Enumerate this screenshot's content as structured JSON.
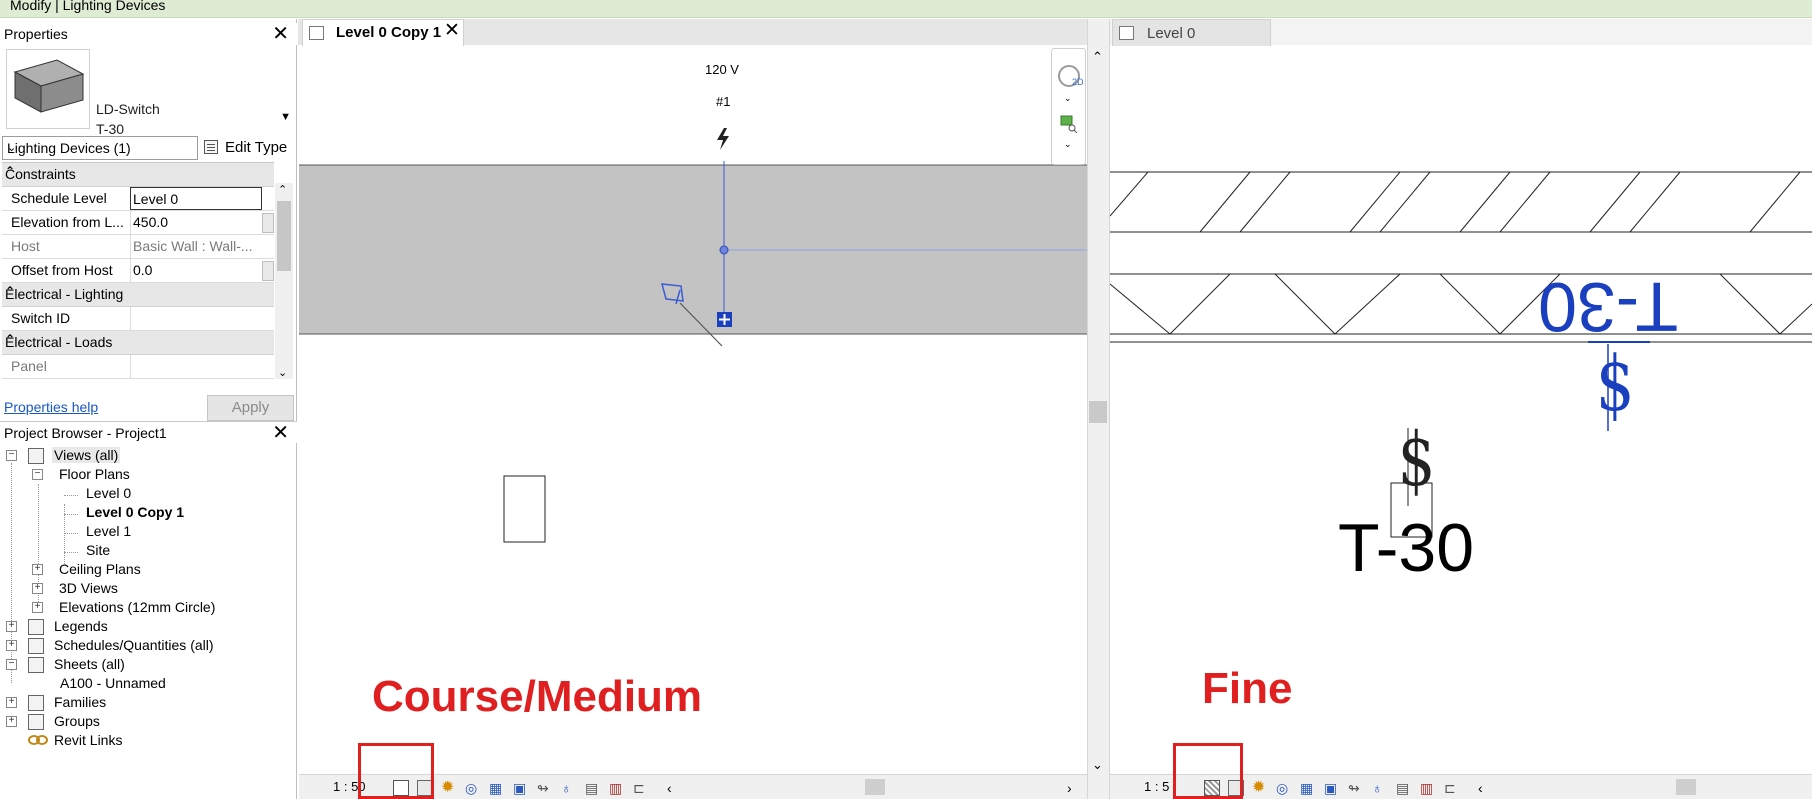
{
  "context_bar": {
    "title": "Modify | Lighting Devices"
  },
  "properties": {
    "title": "Properties",
    "type_family": "LD-Switch",
    "type_name": "T-30",
    "category_selector": "Lighting Devices (1)",
    "edit_type_label": "Edit Type",
    "groups": {
      "constraints": "Constraints",
      "electrical_lighting": "Electrical - Lighting",
      "electrical_loads": "Electrical - Loads"
    },
    "rows": {
      "schedule_level": {
        "label": "Schedule Level",
        "value": "Level 0"
      },
      "elevation": {
        "label": "Elevation from L...",
        "value": "450.0"
      },
      "host": {
        "label": "Host",
        "value": "Basic Wall : Wall-..."
      },
      "offset": {
        "label": "Offset from Host",
        "value": "0.0"
      },
      "switch_id": {
        "label": "Switch ID",
        "value": ""
      },
      "panel": {
        "label": "Panel",
        "value": ""
      }
    },
    "help_link": "Properties help",
    "apply_label": "Apply"
  },
  "project_browser": {
    "title": "Project Browser - Project1",
    "items": [
      {
        "label": "Views (all)"
      },
      {
        "label": "Floor Plans"
      },
      {
        "label": "Level 0"
      },
      {
        "label": "Level 0 Copy 1"
      },
      {
        "label": "Level 1"
      },
      {
        "label": "Site"
      },
      {
        "label": "Ceiling Plans"
      },
      {
        "label": "3D Views"
      },
      {
        "label": "Elevations (12mm Circle)"
      },
      {
        "label": "Legends"
      },
      {
        "label": "Schedules/Quantities (all)"
      },
      {
        "label": "Sheets (all)"
      },
      {
        "label": "A100 - Unnamed"
      },
      {
        "label": "Families"
      },
      {
        "label": "Groups"
      },
      {
        "label": "Revit Links"
      }
    ]
  },
  "tabs": {
    "left": "Level 0 Copy 1",
    "right": "Level 0"
  },
  "view_left": {
    "voltage": "120 V",
    "circuit": "#1",
    "scale": "1 : 50",
    "annotation": "Course/Medium"
  },
  "view_right": {
    "tag": "T-30",
    "tag_mirrored": "T-30",
    "symbol": "$",
    "scale": "1 : 5",
    "annotation": "Fine"
  },
  "colors": {
    "annotation_red": "#e02020",
    "selection_blue": "#1a3fbf",
    "context_green": "#dfecd4"
  }
}
